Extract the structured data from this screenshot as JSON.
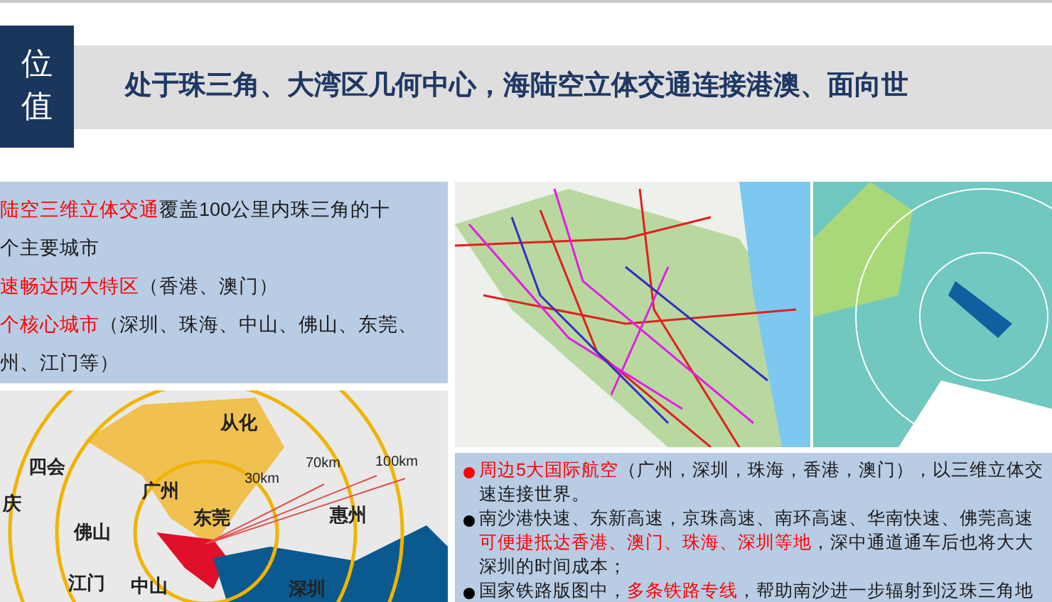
{
  "header": {
    "badge_lines": [
      "位",
      "值"
    ],
    "title": "处于珠三角、大湾区几何中心，海陆空立体交通连接港澳、面向世"
  },
  "left_panel": {
    "lines": [
      [
        {
          "text": "陆空三维立体交通",
          "emphasis": true
        },
        {
          "text": "覆盖100公里内珠三角的十",
          "emphasis": false
        }
      ],
      [
        {
          "text": "个主要城市",
          "emphasis": false
        }
      ],
      [
        {
          "text": "速畅达两大特区",
          "emphasis": true
        },
        {
          "text": "（香港、澳门）",
          "emphasis": false
        }
      ],
      [
        {
          "text": "个核心城市",
          "emphasis": true
        },
        {
          "text": "（深圳、珠海、中山、佛山、东莞、",
          "emphasis": false
        }
      ],
      [
        {
          "text": "州、江门等）",
          "emphasis": false
        }
      ]
    ]
  },
  "radius_map": {
    "labels": [
      {
        "text": "从化",
        "kind": "city"
      },
      {
        "text": "四会",
        "kind": "city"
      },
      {
        "text": "庆",
        "kind": "city"
      },
      {
        "text": "广州",
        "kind": "city"
      },
      {
        "text": "东莞",
        "kind": "city"
      },
      {
        "text": "佛山",
        "kind": "city"
      },
      {
        "text": "惠州",
        "kind": "city"
      },
      {
        "text": "江门",
        "kind": "city"
      },
      {
        "text": "中山",
        "kind": "city"
      },
      {
        "text": "深圳",
        "kind": "city"
      },
      {
        "text": "30km",
        "kind": "distance"
      },
      {
        "text": "70km",
        "kind": "distance"
      },
      {
        "text": "100km",
        "kind": "distance"
      }
    ]
  },
  "bottom_panel": {
    "bullets": [
      {
        "color": "#ff0000",
        "lines": [
          [
            {
              "text": "周边5大国际航空",
              "emphasis": true
            },
            {
              "text": "（广州，深圳，珠海，香港，澳门），以三维立体交",
              "emphasis": false
            }
          ],
          [
            {
              "text": "速连接世界。",
              "emphasis": false
            }
          ]
        ]
      },
      {
        "color": "#000000",
        "lines": [
          [
            {
              "text": "南沙港快速、东新高速，京珠高速、南环高速、华南快速、佛莞高速",
              "emphasis": false
            }
          ],
          [
            {
              "text": "可便捷抵达香港、澳门、珠海、深圳等地",
              "emphasis": true
            },
            {
              "text": "，深中通道通车后也将大大",
              "emphasis": false
            }
          ],
          [
            {
              "text": "深圳的时间成本；",
              "emphasis": false
            }
          ]
        ]
      },
      {
        "color": "#000000",
        "lines": [
          [
            {
              "text": "国家铁路版图中，",
              "emphasis": false
            },
            {
              "text": "多条铁路专线",
              "emphasis": true
            },
            {
              "text": "，帮助南沙进一步辐射到泛珠三角地",
              "emphasis": false
            }
          ]
        ]
      }
    ]
  }
}
